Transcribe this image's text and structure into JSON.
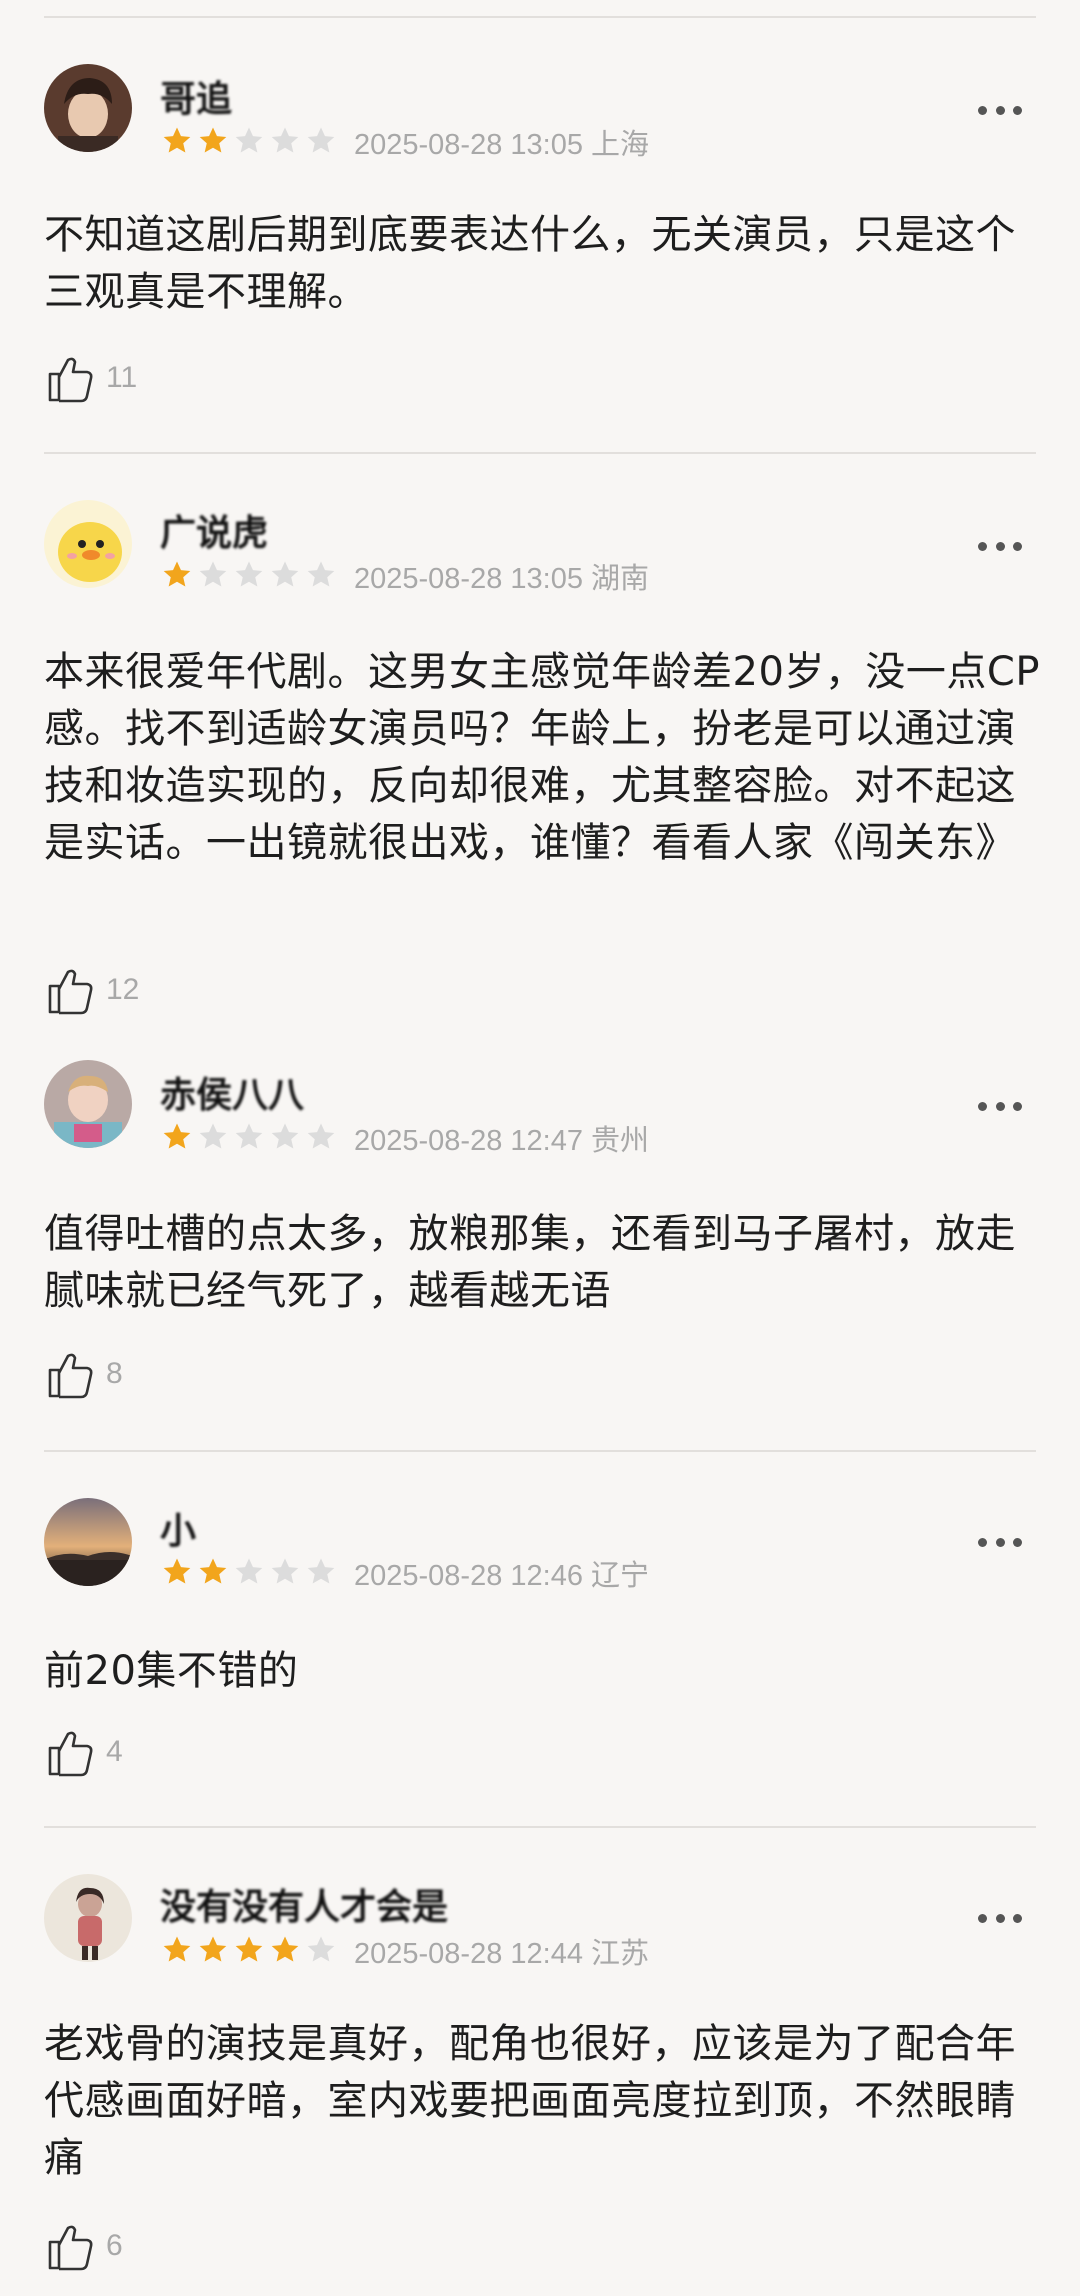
{
  "reviews": [
    {
      "username": "哥追",
      "stars": 2,
      "time": "2025-08-28 13:05",
      "location": "上海",
      "text": "不知道这剧后期到底要表达什么，无关演员，只是这个三观真是不理解。",
      "likes": "11",
      "avatar_icon": "boy-portrait-avatar",
      "colors": {
        "avatar_bg": "#6b4a3a",
        "skin": "#e8c9b0"
      }
    },
    {
      "username": "广说虎",
      "stars": 1,
      "time": "2025-08-28 13:05",
      "location": "湖南",
      "text": "本来很爱年代剧。这男女主感觉年龄差20岁，没一点CP感。找不到适龄女演员吗？年龄上，扮老是可以通过演技和妆造实现的，反向却很难，尤其整容脸。对不起这是实话。一出镜就很出戏，谁懂？看看人家《闯关东》",
      "likes": "12",
      "avatar_icon": "yellow-duck-avatar",
      "colors": {
        "avatar_bg": "#fbf3d4",
        "skin": "#f7d64a"
      }
    },
    {
      "username": "赤侯八八",
      "stars": 1,
      "time": "2025-08-28 12:47",
      "location": "贵州",
      "text": "值得吐槽的点太多，放粮那集，还看到马子屠村，放走腻味就已经气死了，越看越无语",
      "likes": "8",
      "avatar_icon": "baby-photo-avatar",
      "colors": {
        "avatar_bg": "#c9b8b3",
        "skin": "#f0d2c2"
      }
    },
    {
      "username": "小",
      "stars": 2,
      "time": "2025-08-28 12:46",
      "location": "辽宁",
      "text": "前20集不错的",
      "likes": "4",
      "avatar_icon": "sunset-photo-avatar",
      "colors": {
        "avatar_bg": "#c89a6a",
        "skin": "#3b2f2a"
      }
    },
    {
      "username": "没有没有人才会是",
      "stars": 4,
      "time": "2025-08-28 12:44",
      "location": "江苏",
      "text": "老戏骨的演技是真好，配角也很好，应该是为了配合年代感画面好暗，室内戏要把画面亮度拉到顶，不然眼睛痛",
      "likes": "6",
      "avatar_icon": "girl-photo-avatar",
      "colors": {
        "avatar_bg": "#ece6dc",
        "skin": "#caa395"
      }
    }
  ],
  "colors": {
    "star_on": "#f2a51c",
    "star_off": "#dcdcdc",
    "meta": "#a8a8a8",
    "divider": "#e2dfdc"
  },
  "icons": {
    "like": "thumbs-up-icon",
    "more": "more-dots-icon",
    "star": "star-icon"
  }
}
